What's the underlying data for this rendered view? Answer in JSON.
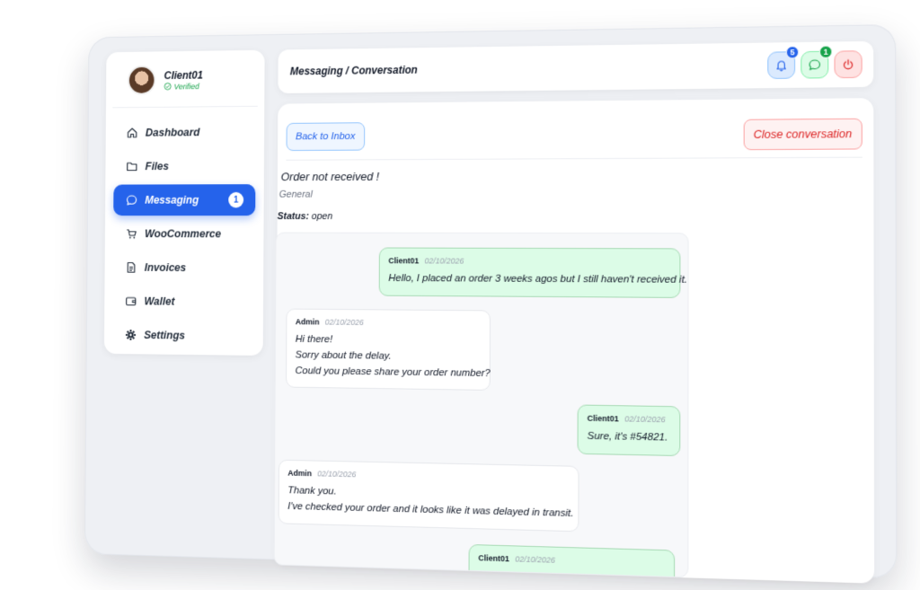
{
  "user": {
    "name": "Client01",
    "status": "Verified"
  },
  "sidebar": {
    "items": [
      {
        "label": "Dashboard",
        "icon": "home-icon"
      },
      {
        "label": "Files",
        "icon": "folder-icon"
      },
      {
        "label": "Messaging",
        "icon": "chat-icon",
        "active": true,
        "badge": "1"
      },
      {
        "label": "WooCommerce",
        "icon": "cart-icon"
      },
      {
        "label": "Invoices",
        "icon": "document-icon"
      },
      {
        "label": "Wallet",
        "icon": "wallet-icon"
      },
      {
        "label": "Settings",
        "icon": "gear-icon"
      }
    ]
  },
  "header": {
    "breadcrumb": "Messaging / Conversation",
    "notifications_count": "5",
    "messages_count": "1"
  },
  "conversation": {
    "back_label": "Back to Inbox",
    "close_label": "Close conversation",
    "subject": "Order not received !",
    "category": "General",
    "status_label": "Status:",
    "status_value": "open",
    "messages": [
      {
        "author": "Client01",
        "date": "02/10/2026",
        "lines": [
          "Hello, I placed an order 3 weeks agos but I still haven't received it."
        ]
      },
      {
        "author": "Admin",
        "date": "02/10/2026",
        "lines": [
          "Hi there!",
          "Sorry about the delay.",
          "Could you please share your order number?"
        ]
      },
      {
        "author": "Client01",
        "date": "02/10/2026",
        "lines": [
          "Sure, it's #54821."
        ]
      },
      {
        "author": "Admin",
        "date": "02/10/2026",
        "lines": [
          "Thank you.",
          "I've checked your order and it looks like it was delayed in transit."
        ]
      },
      {
        "author": "Client01",
        "date": "02/10/2026",
        "lines": []
      }
    ]
  },
  "colors": {
    "accent": "#2563eb",
    "success": "#16a34a",
    "danger": "#dc2626",
    "client_bubble": "#dcfce7"
  }
}
